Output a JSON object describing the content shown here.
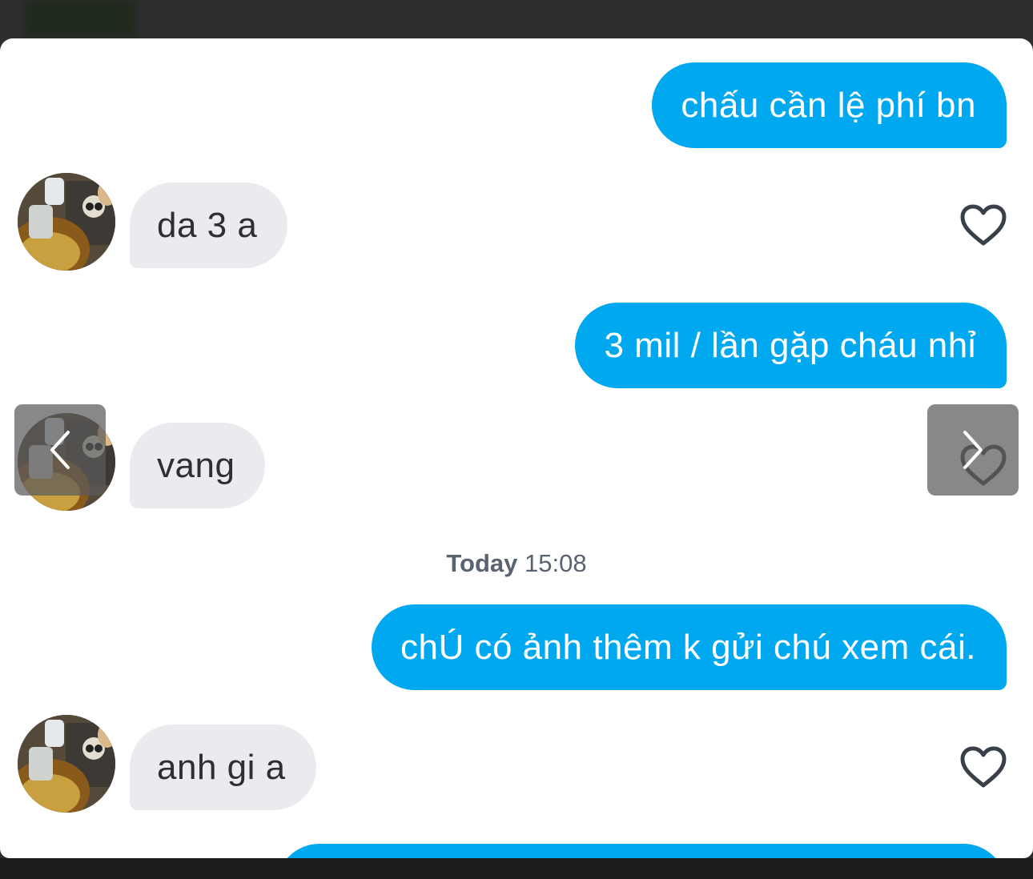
{
  "colors": {
    "outgoing_bubble": "#00a8f0",
    "incoming_bubble": "#ebebef",
    "heart_outline": "#3a4049",
    "timestamp_text": "#5a6470"
  },
  "messages": [
    {
      "direction": "outgoing",
      "text": "chấu cần lệ phí bn"
    },
    {
      "direction": "incoming",
      "text": "da 3 a",
      "liked_icon": "heart-outline-icon"
    },
    {
      "direction": "outgoing",
      "text": "3 mil / lần gặp cháu nhỉ"
    },
    {
      "direction": "incoming",
      "text": "vang",
      "liked_icon": "heart-outline-icon"
    },
    {
      "direction": "outgoing",
      "text": "chÚ có ảnh thêm k gửi chú xem cái."
    },
    {
      "direction": "incoming",
      "text": "anh gi a",
      "liked_icon": "heart-outline-icon"
    }
  ],
  "timestamp": {
    "day": "Today",
    "time": "15:08"
  },
  "navigation": {
    "prev_icon": "chevron-left-icon",
    "next_icon": "chevron-right-icon"
  }
}
